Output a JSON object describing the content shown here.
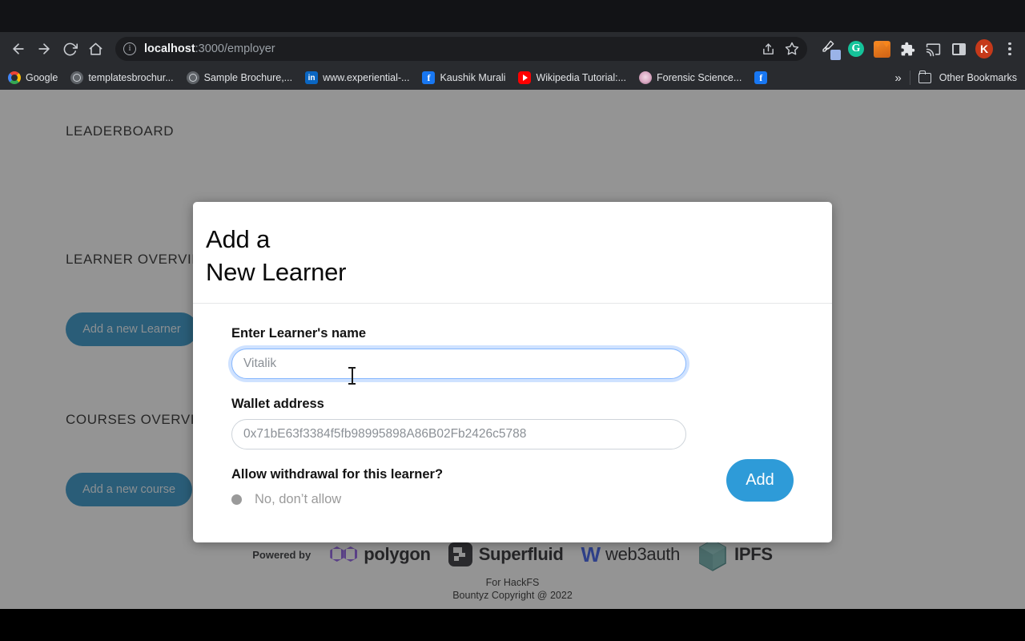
{
  "browser": {
    "nav": {
      "back": "back-arrow",
      "forward": "forward-arrow",
      "reload": "reload",
      "home": "home"
    },
    "omnibox": {
      "info_icon": "site-information",
      "url_host": "localhost",
      "url_path": ":3000/employer",
      "share_icon": "share",
      "bookmark_icon": "star"
    },
    "toolbar_icons": [
      {
        "name": "eyedropper-extension",
        "label": "Color picker"
      },
      {
        "name": "grammarly-extension",
        "label": "G"
      },
      {
        "name": "metamask-extension",
        "label": "MetaMask"
      },
      {
        "name": "extensions-puzzle",
        "label": "Extensions"
      },
      {
        "name": "cast-icon",
        "label": "Cast"
      },
      {
        "name": "side-panel-icon",
        "label": "Side panel"
      },
      {
        "name": "profile-avatar",
        "label": "K"
      },
      {
        "name": "chrome-menu",
        "label": "Menu"
      }
    ],
    "bookmarks": [
      {
        "label": "Google",
        "icon": "google-icon"
      },
      {
        "label": "templatesbrochur...",
        "icon": "globe-icon"
      },
      {
        "label": "Sample Brochure,...",
        "icon": "globe-icon"
      },
      {
        "label": "www.experiential-...",
        "icon": "linkedin-icon"
      },
      {
        "label": "Kaushik Murali",
        "icon": "facebook-icon"
      },
      {
        "label": "Wikipedia Tutorial:...",
        "icon": "youtube-icon"
      },
      {
        "label": "Forensic Science...",
        "icon": "forensic-icon"
      },
      {
        "label": "",
        "icon": "facebook-icon"
      }
    ],
    "bookmarks_overflow": "»",
    "other_bookmarks": "Other Bookmarks"
  },
  "page": {
    "sections": [
      {
        "title": "LEADERBOARD"
      },
      {
        "title": "LEARNER OVERVIEW"
      },
      {
        "title": "COURSES OVERVIEW"
      }
    ],
    "buttons": [
      {
        "label": "Add a new Learner"
      },
      {
        "label": "Add a new course"
      }
    ],
    "footer": {
      "powered_by": "Powered by",
      "brands": [
        {
          "name": "polygon",
          "icon": "polygon-logo"
        },
        {
          "name": "Superfluid",
          "icon": "superfluid-logo"
        },
        {
          "name": "web3auth",
          "icon": "web3auth-logo"
        },
        {
          "name": "IPFS",
          "icon": "ipfs-logo"
        }
      ],
      "line1": "For HackFS",
      "line2": "Bountyz Copyright @ 2022"
    }
  },
  "modal": {
    "title_line1": "Add a",
    "title_line2": "New Learner",
    "name_field": {
      "label": "Enter Learner's name",
      "value": "",
      "placeholder": "Vitalik"
    },
    "wallet_field": {
      "label": "Wallet address",
      "value": "",
      "placeholder": "0x71bE63f3384f5fb98995898A86B02Fb2426c5788"
    },
    "withdrawal": {
      "label": "Allow withdrawal for this learner?",
      "option_label": "No, don’t allow"
    },
    "submit_label": "Add"
  },
  "colors": {
    "accent_blue": "#2e9bd8",
    "page_button_blue": "#1586c0",
    "polygon_purple": "#8247e5",
    "web3auth_blue": "#1f48e8",
    "ipfs_teal": "#469ea2",
    "scrim": "#808080"
  }
}
